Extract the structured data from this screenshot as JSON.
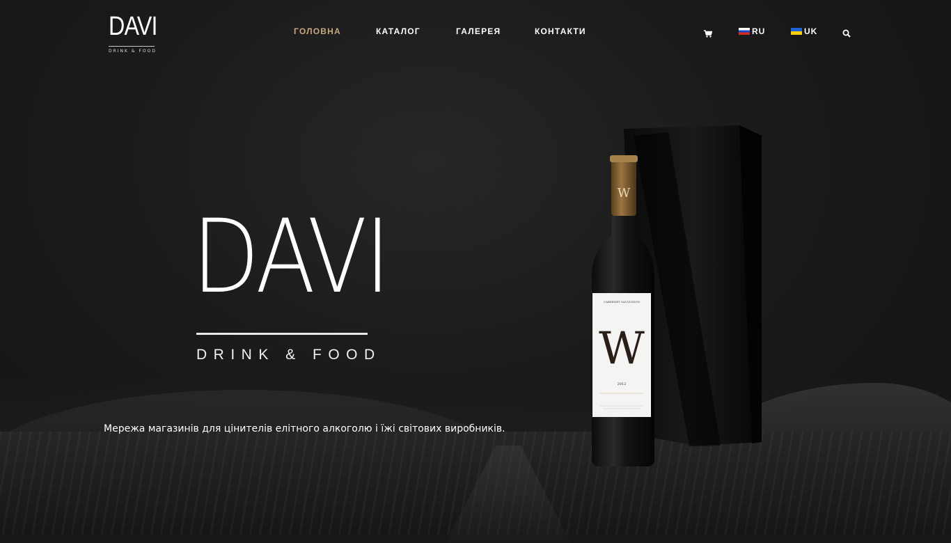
{
  "header": {
    "logo": {
      "main": "DAVI",
      "sub": "DRINK & FOOD"
    },
    "nav": [
      {
        "label": "ГОЛОВНА",
        "active": true
      },
      {
        "label": "КАТАЛОГ",
        "active": false
      },
      {
        "label": "ГАЛЕРЕЯ",
        "active": false
      },
      {
        "label": "КОНТАКТИ",
        "active": false
      }
    ],
    "cart_icon": "shopping-cart-icon",
    "languages": [
      {
        "code": "RU",
        "flag": "russia-flag"
      },
      {
        "code": "UK",
        "flag": "ukraine-flag"
      }
    ],
    "search_icon": "search-icon"
  },
  "hero": {
    "title": "DAVI",
    "subtitle": "DRINK & FOOD",
    "tagline": "Мережа магазинів для цінителів елітного алкоголю і їжі світових виробників."
  },
  "product": {
    "label_letter": "W",
    "label_top": "CABERNET SAUVIGNON",
    "label_year": "2012"
  },
  "colors": {
    "accent": "#c9a97e",
    "background": "#171717",
    "text": "#ffffff"
  }
}
